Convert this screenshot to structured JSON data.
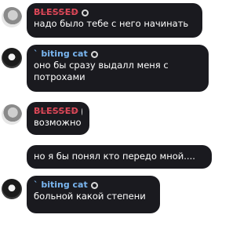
{
  "messages": [
    {
      "author": "BLESSED",
      "author_icon": "avatar-badge-icon",
      "text": "надо было тебе с него начинать"
    },
    {
      "author": "` biting cat",
      "author_icon": "avatar-badge-icon",
      "text_lines": [
        "оно бы сразу выдалл меня с",
        "потрохами"
      ]
    },
    {
      "author": "BLESSED",
      "author_icon": "avatar-badge-icon",
      "text": "возможно"
    },
    {
      "text": "но я бы понял кто передо мной...."
    },
    {
      "author": "` biting cat",
      "author_icon": "avatar-badge-icon",
      "text": "больной какой степени"
    }
  ],
  "colors": {
    "bubble": "#1a1a1f",
    "blessed_name": "#e24b5b",
    "cat_name": "#7ab6f0",
    "text": "#ffffff"
  }
}
